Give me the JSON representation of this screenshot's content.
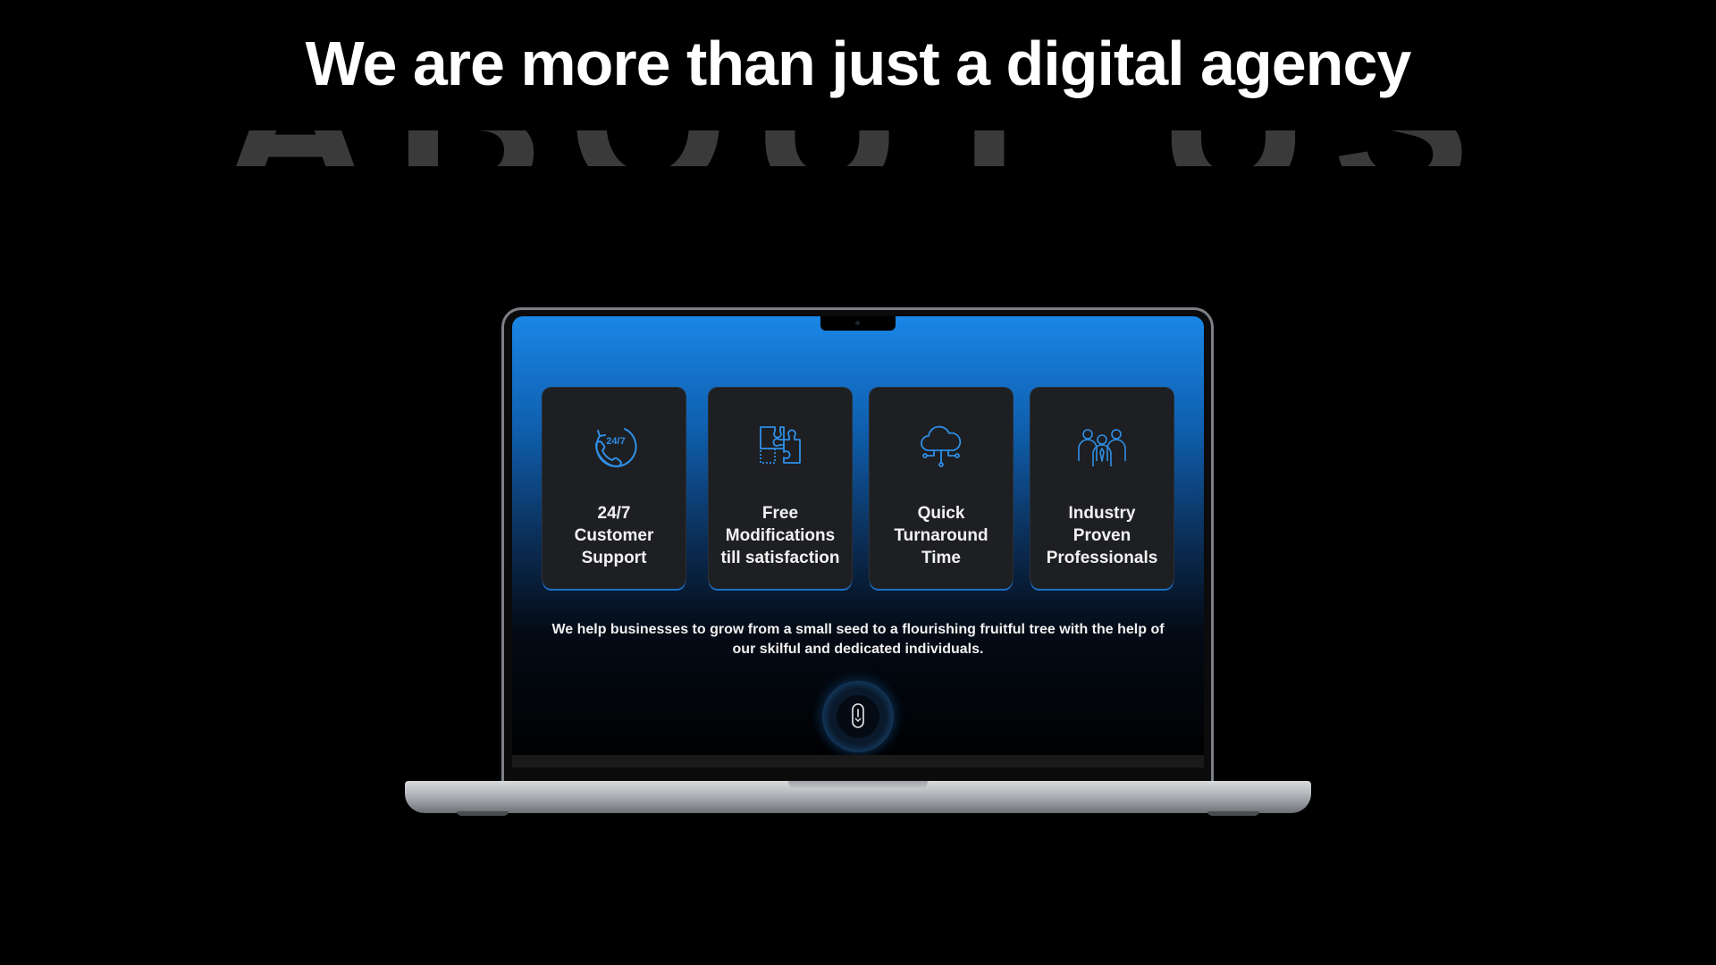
{
  "page": {
    "headline": "We are more than just a digital agency",
    "background_word": "ABOUT US"
  },
  "laptop": {
    "screen": {
      "cards": [
        {
          "icon": "phone-24-7-icon",
          "label": "24/7\nCustomer\nSupport",
          "icon_text": "24/7"
        },
        {
          "icon": "puzzle-icon",
          "label": "Free\nModifications\ntill satisfaction"
        },
        {
          "icon": "cloud-network-icon",
          "label": "Quick\nTurnaround\nTime"
        },
        {
          "icon": "team-icon",
          "label": "Industry\nProven\nProfessionals"
        }
      ],
      "tagline": "We help businesses to grow from a small seed to a flourishing fruitful tree with the help of our skilful and dedicated individuals.",
      "scroll_indicator_icon": "mouse-scroll-icon"
    }
  },
  "colors": {
    "background": "#000000",
    "accent_blue": "#1a86e6",
    "icon_blue": "#2f8fe6",
    "card_bg": "#1d1f22"
  }
}
